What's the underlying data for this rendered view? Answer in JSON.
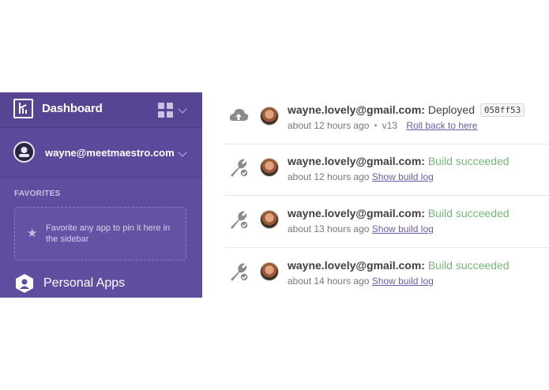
{
  "sidebar": {
    "title": "Dashboard",
    "account_email": "wayne@meetmaestro.com",
    "favorites_label": "FAVORITES",
    "favorites_hint": "Favorite any app to pin it here in the sidebar",
    "personal_apps_label": "Personal Apps",
    "colors": {
      "background": "#5f4d9f",
      "header": "#574594"
    }
  },
  "feed": {
    "entries": [
      {
        "icon": "cloud-upload-icon",
        "email": "wayne.lovely@gmail.com:",
        "action": "Deployed",
        "code": "058ff53",
        "time": "about 12 hours ago",
        "version": "v13",
        "link": "Roll back to here"
      },
      {
        "icon": "wrench-check-icon",
        "email": "wayne.lovely@gmail.com:",
        "status": "Build succeeded",
        "time": "about 12 hours ago",
        "link": "Show build log"
      },
      {
        "icon": "wrench-check-icon",
        "email": "wayne.lovely@gmail.com:",
        "status": "Build succeeded",
        "time": "about 13 hours ago",
        "link": "Show build log"
      },
      {
        "icon": "wrench-check-icon",
        "email": "wayne.lovely@gmail.com:",
        "status": "Build succeeded",
        "time": "about 14 hours ago",
        "link": "Show build log"
      }
    ],
    "colors": {
      "success": "#74b776",
      "link": "#6f5ba8"
    }
  }
}
